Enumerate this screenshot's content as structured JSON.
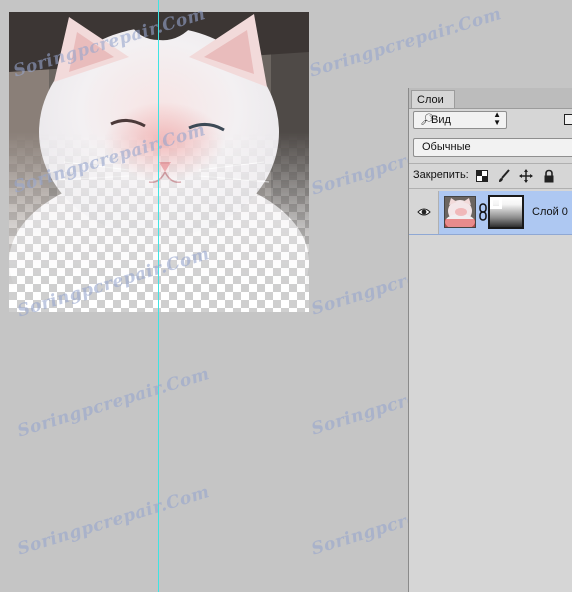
{
  "layers_panel": {
    "tab_label": "Слои",
    "filter": {
      "icon": "search-icon",
      "label": "Вид"
    },
    "blend_mode": "Обычные",
    "lock": {
      "label": "Закрепить:",
      "icons": [
        "lock-transparent-pixels-icon",
        "lock-image-pixels-icon",
        "lock-position-icon",
        "lock-all-icon"
      ]
    },
    "layers": [
      {
        "name": "Слой 0",
        "visible": true,
        "selected": true,
        "has_mask": true
      }
    ]
  },
  "watermark_text": "Soringpcrepair.Com",
  "colors": {
    "guide": "#3fe3e3",
    "selected_layer": "#aec8f2",
    "background": "#c5c5c5"
  }
}
